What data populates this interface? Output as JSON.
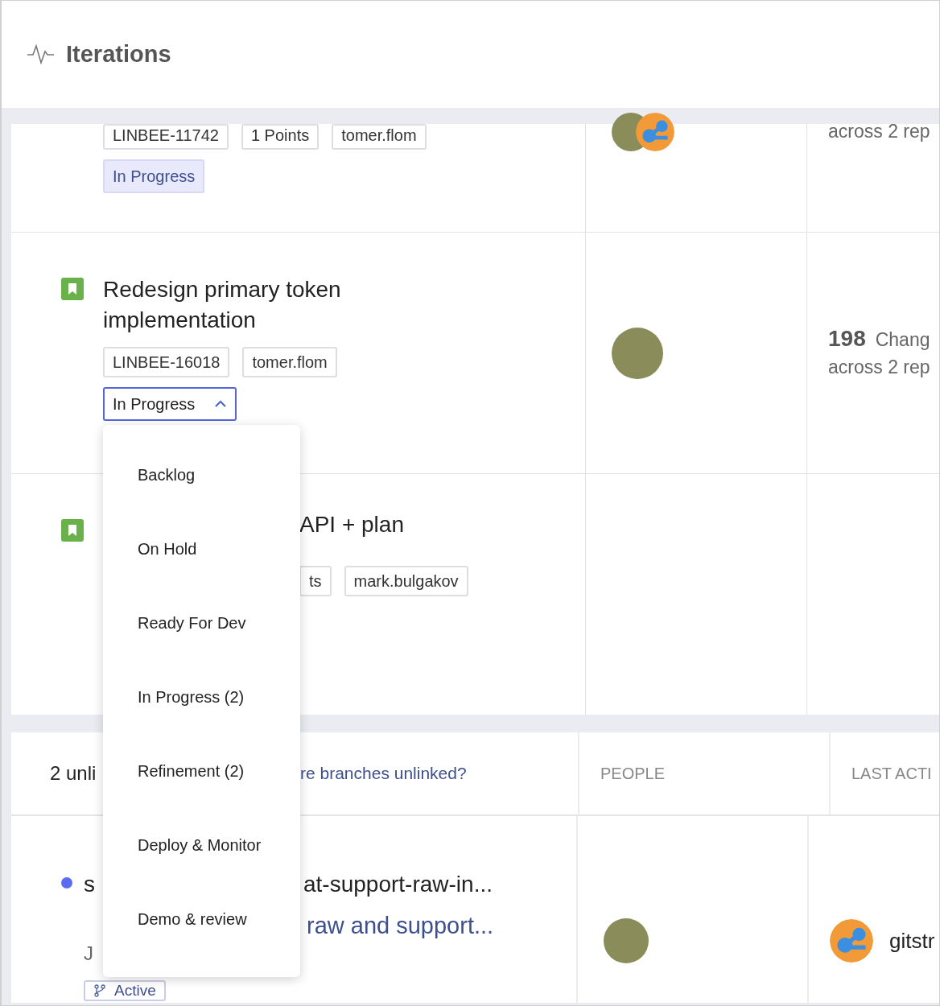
{
  "header": {
    "title": "Iterations"
  },
  "work_items": [
    {
      "tags": [
        "LINBEE-11742",
        "1 Points",
        "tomer.flom"
      ],
      "status": {
        "label": "In Progress",
        "open": false
      },
      "people": [
        {
          "kind": "photo"
        },
        {
          "kind": "logo"
        }
      ],
      "activity_line_2": "across 2 rep"
    },
    {
      "title": "Redesign primary token implementation",
      "tags": [
        "LINBEE-16018",
        "tomer.flom"
      ],
      "status": {
        "label": "In Progress",
        "open": true
      },
      "people": [
        {
          "kind": "photo"
        }
      ],
      "changes_count": "198",
      "changes_label": "Chang",
      "activity_line_2": "across 2 rep"
    },
    {
      "title": "API + plan",
      "tags": [
        "ts",
        "mark.bulgakov"
      ]
    }
  ],
  "status_menu": {
    "options": [
      "Backlog",
      "On Hold",
      "Ready For Dev",
      "In Progress (2)",
      "Refinement (2)",
      "Deploy & Monitor",
      "Demo & review"
    ]
  },
  "unlinked": {
    "count_text": "2 unli",
    "link": "re branches unlinked?",
    "columns": [
      "PEOPLE",
      "LAST ACTI"
    ]
  },
  "branches": [
    {
      "color": "#5b6cf0",
      "prefix": "s",
      "name": "at-support-raw-in...",
      "title": "raw and support...",
      "author": "J",
      "state": "Active",
      "people": [
        {
          "kind": "photo"
        }
      ],
      "last_activity": {
        "kind": "logo",
        "text": "gitstr"
      }
    }
  ]
}
